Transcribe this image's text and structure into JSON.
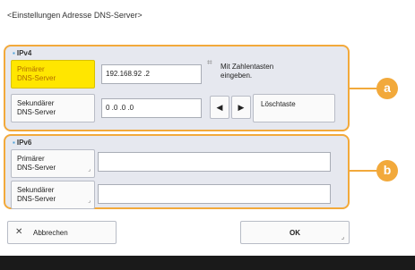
{
  "title": "<Einstellungen Adresse DNS-Server>",
  "ipv4": {
    "label": "IPv4",
    "primary_label": [
      "Primärer",
      "DNS-Server"
    ],
    "primary_value": "192.168.92 .2",
    "secondary_label": [
      "Sekundärer",
      "DNS-Server"
    ],
    "secondary_value": "0 .0 .0 .0",
    "hint": [
      "Mit Zahlentasten",
      "eingeben."
    ],
    "left_arrow": "◀",
    "right_arrow": "▶",
    "backspace_label": "Löschtaste"
  },
  "ipv6": {
    "label": "IPv6",
    "primary_label": [
      "Primärer",
      "DNS-Server"
    ],
    "primary_value": "",
    "secondary_label": [
      "Sekundärer",
      "DNS-Server"
    ],
    "secondary_value": ""
  },
  "callouts": {
    "a": "a",
    "b": "b"
  },
  "buttons": {
    "cancel": "Abbrechen",
    "ok": "OK"
  },
  "colors": {
    "accent": "#f2a93b",
    "active": "#ffe600",
    "panel": "#e6e8ef"
  }
}
